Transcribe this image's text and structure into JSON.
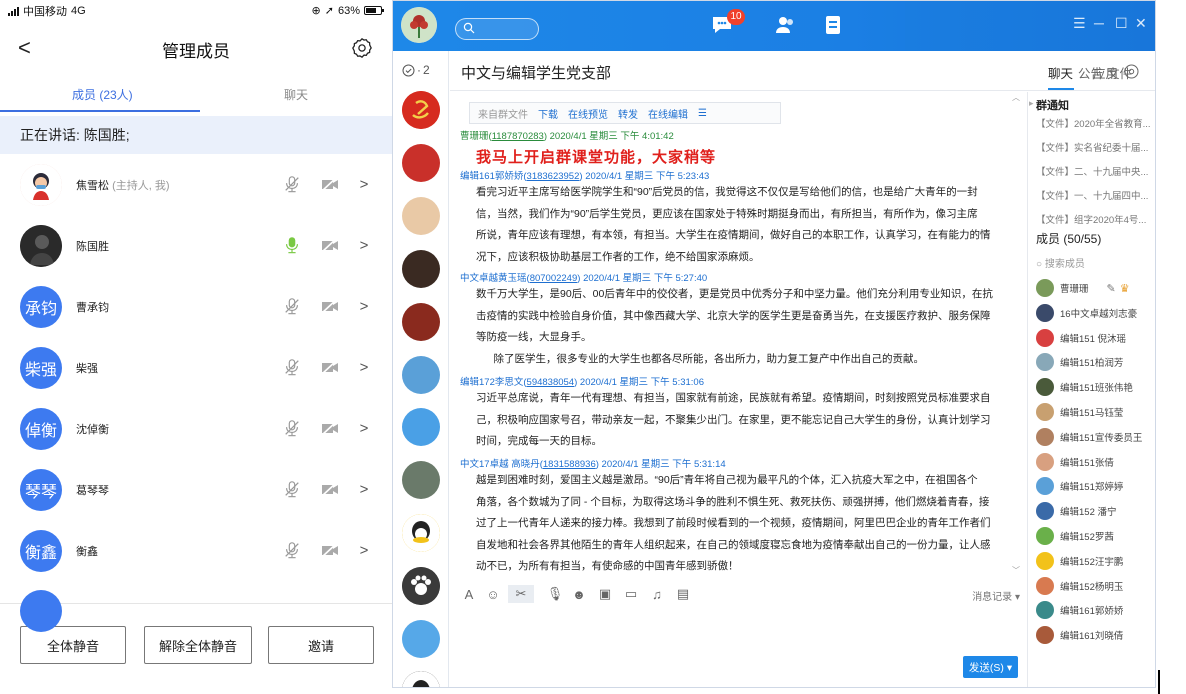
{
  "phone": {
    "status": {
      "carrier": "中国移动",
      "network": "4G",
      "battery": "63%"
    },
    "header": {
      "title": "管理成员",
      "back": "<"
    },
    "tabs": {
      "members": "成员 (23人)",
      "chat": "聊天"
    },
    "speaking": "正在讲话: 陈国胜;",
    "members": [
      {
        "name": "焦雪松",
        "role": "(主持人, 我)",
        "avatar_text": "",
        "mic": "muted"
      },
      {
        "name": "陈国胜",
        "role": "",
        "avatar_text": "",
        "mic": "active"
      },
      {
        "name": "曹承钧",
        "role": "",
        "avatar_text": "承钧",
        "mic": "muted"
      },
      {
        "name": "柴强",
        "role": "",
        "avatar_text": "柴强",
        "mic": "muted"
      },
      {
        "name": "沈倬衡",
        "role": "",
        "avatar_text": "倬衡",
        "mic": "muted"
      },
      {
        "name": "葛琴琴",
        "role": "",
        "avatar_text": "琴琴",
        "mic": "muted"
      },
      {
        "name": "衡鑫",
        "role": "",
        "avatar_text": "衡鑫",
        "mic": "muted"
      }
    ],
    "footer": {
      "mute_all": "全体静音",
      "unmute_all": "解除全体静音",
      "invite": "邀请"
    },
    "colors": {
      "accent": "#3d6fe0",
      "avatar_blue": "#3d7af0",
      "mic_active": "#7ac943"
    }
  },
  "qq": {
    "topbar": {
      "notify_badge": "10"
    },
    "sidebar": {
      "unread": "2"
    },
    "chat": {
      "group_name": "中文与编辑学生党支部",
      "tabs": [
        "聊天",
        "公告",
        "文件",
        "应用"
      ],
      "file_card": {
        "source": "来自群文件",
        "actions": [
          "下载",
          "在线预览",
          "转发",
          "在线编辑"
        ]
      },
      "messages": [
        {
          "sender": "曹珊珊",
          "uid": "1187870283",
          "time": "2020/4/1 星期三 下午 4:01:42",
          "color": "#2a8c3c",
          "text": "我马上开启群课堂功能，大家稍等"
        },
        {
          "sender": "编辑161郭娇娇",
          "uid": "3183623952",
          "time": "2020/4/1 星期三 下午 5:23:43",
          "color": "#1e6fd0",
          "lines": [
            "看完习近平主席写给医学院学生和“90”后党员的信，我觉得这不仅仅是写给他们的信，也是给广大青年的一封",
            "信，当然，我们作为“90”后学生党员，更应该在国家处于特殊时期挺身而出，有所担当，有所作为，像习主席",
            "所说，青年应该有理想，有本领，有担当。大学生在疫情期间，做好自己的本职工作，认真学习，在有能力的情",
            "况下，应该积极协助基层工作者的工作，绝不给国家添麻烦。"
          ]
        },
        {
          "sender": "中文卓越黄玉瑶",
          "uid": "807002249",
          "time": "2020/4/1 星期三 下午 5:27:40",
          "color": "#1e6fd0",
          "lines": [
            "数千万大学生，是90后、00后青年中的佼佼者，更是党员中优秀分子和中坚力量。他们充分利用专业知识，在抗",
            "击疫情的实践中检验自身价值，其中像西藏大学、北京大学的医学生更是奋勇当先，在支援医疗救护、服务保障",
            "等防疫一线，大显身手。",
            "      除了医学生，很多专业的大学生也都各尽所能，各出所力，助力复工复产中作出自己的贡献。"
          ]
        },
        {
          "sender": "编辑172李思文",
          "uid": "594838054",
          "time": "2020/4/1 星期三 下午 5:31:06",
          "color": "#1e6fd0",
          "lines": [
            "习近平总席说，青年一代有理想、有担当，国家就有前途，民族就有希望。疫情期间，时刻按照党员标准要求自",
            "己，积极响应国家号召，带动亲友一起，不聚集少出门。在家里，更不能忘记自己大学生的身份，认真计划学习",
            "时间，完成每一天的目标。"
          ]
        },
        {
          "sender": "中文17卓越 高晓丹",
          "uid": "1831588936",
          "time": "2020/4/1 星期三 下午 5:31:14",
          "color": "#1e6fd0",
          "lines": [
            "越是到困难时刻，爱国主义越是激昂。“90后”青年将自己视为最平凡的个体，汇入抗疫大军之中，在祖国各个",
            "角落，各个数城为了同 - 个目标，为取得这场斗争的胜利不惧生死、救死扶伤、顽强拼搏，他们燃烧着青春，接",
            "过了上一代青年人递来的接力棒。我想到了前段时候看到的一个视频，疫情期间，阿里巴巴企业的青年工作者们",
            "自发地和社会各界其他陌生的青年人组织起来，在自己的领域度寝忘食地为疫情奉献出自己的一份力量，让人感",
            "动不已，为所有有担当，有使命感的中国青年感到骄傲！"
          ]
        }
      ],
      "history": "消息记录 ▾",
      "send": "发送(S) ▾"
    },
    "right_panel": {
      "notice_title": "群通知",
      "notices": [
        "【文件】2020年全省教育...",
        "【文件】实名省纪委十届...",
        "【文件】二、十九届中央...",
        "【文件】一、十九届四中...",
        "【文件】组字2020年4号..."
      ],
      "members_title": "成员 (50/55)",
      "search_placeholder": "搜索成员",
      "members": [
        "曹珊珊",
        "16中文卓越刘志豪",
        "编辑151  倪沐瑶",
        "编辑151柏润芳",
        "编辑151班张伟艳",
        "编辑151马钰莹",
        "编辑151宣传委员王",
        "编辑151张倩",
        "编辑151郑婷婷",
        "编辑152 潘宁",
        "编辑152罗茜",
        "编辑152汪宇鹏",
        "编辑152杨明玉",
        "编辑161郭娇娇",
        "编辑161刘晓倩"
      ]
    },
    "colors": {
      "topbar": "#1e88e8",
      "badge": "#f0412b",
      "highlight_red": "#e0201c",
      "link": "#1e6fd0"
    }
  }
}
